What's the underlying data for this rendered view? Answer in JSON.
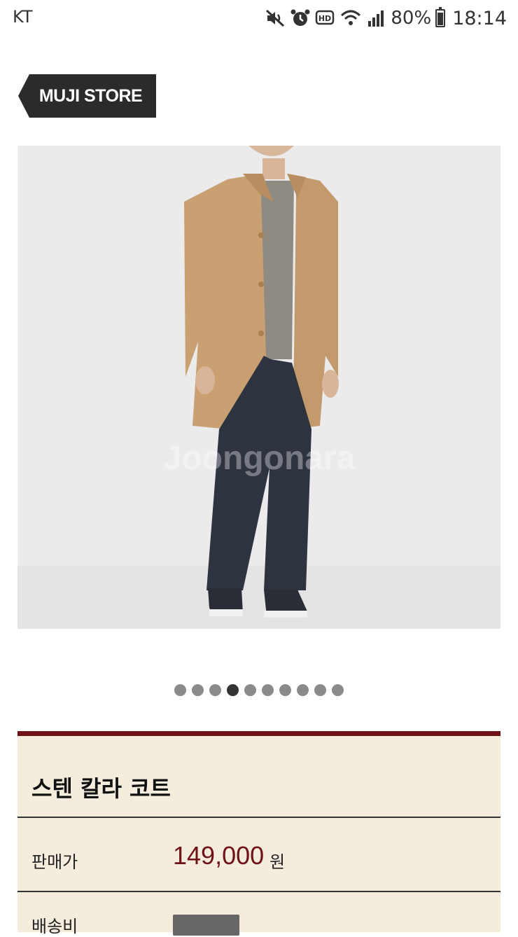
{
  "status_bar": {
    "carrier": "KT",
    "battery": "80%",
    "time": "18:14",
    "icons": [
      "mute-icon",
      "alarm-icon",
      "hd-icon",
      "wifi-icon",
      "signal-icon",
      "battery-icon"
    ]
  },
  "header": {
    "back_label": "MUJI STORE"
  },
  "gallery": {
    "watermark": "Joongonara",
    "dot_count": 10,
    "active_index": 3
  },
  "product": {
    "title": "스텐 칼라 코트",
    "price_label": "판매가",
    "price": "149,000",
    "price_unit": "원",
    "shipping_label": "배송비"
  },
  "colors": {
    "accent": "#6f1218",
    "panel_bg": "#f4ecdd",
    "label_bg": "#2b2b2b"
  }
}
